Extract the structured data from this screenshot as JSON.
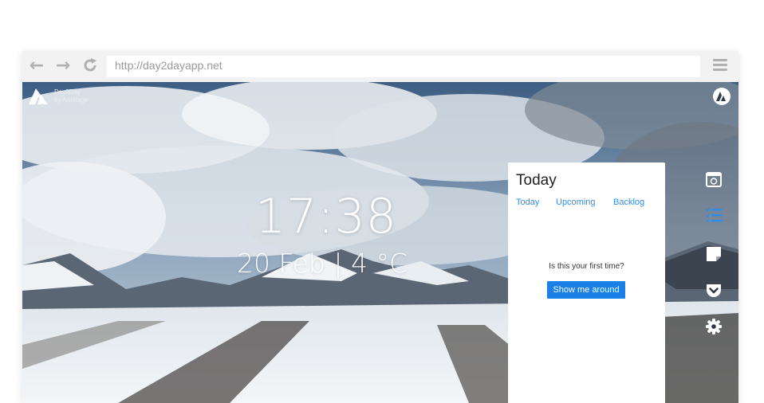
{
  "browser": {
    "url": "http://day2dayapp.net",
    "back_icon": "arrow-left-icon",
    "forward_icon": "arrow-right-icon",
    "reload_icon": "reload-icon",
    "menu_icon": "hamburger-menu-icon"
  },
  "app": {
    "brand_name": "Day2Day",
    "brand_sub": "by Armitage",
    "time": "17:38",
    "date_weather": "20 Feb | 4 °C"
  },
  "panel": {
    "title": "Today",
    "tabs": [
      "Today",
      "Upcoming",
      "Backlog"
    ],
    "prompt": "Is this your first time?",
    "button_label": "Show me around"
  },
  "sidebar": {
    "icons": [
      "calendar-icon",
      "checklist-icon",
      "note-icon",
      "pocket-icon",
      "gear-icon"
    ],
    "active_color": "#2f8dea"
  },
  "colors": {
    "accent": "#1a7fe6",
    "link": "#2f8dea"
  }
}
